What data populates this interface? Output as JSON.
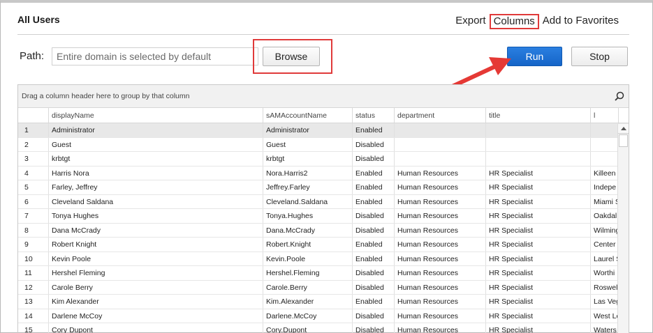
{
  "header": {
    "title": "All Users",
    "export_label": "Export",
    "columns_label": "Columns",
    "favorites_label": "Add to Favorites"
  },
  "path": {
    "label": "Path:",
    "placeholder": "Entire domain is selected by default"
  },
  "buttons": {
    "browse": "Browse",
    "run": "Run",
    "stop": "Stop"
  },
  "grid": {
    "group_hint": "Drag a column header here to group by that column",
    "columns": [
      "displayName",
      "sAMAccountName",
      "status",
      "department",
      "title",
      "l"
    ],
    "rows": [
      [
        "1",
        "Administrator",
        "Administrator",
        "Enabled",
        "",
        "",
        ""
      ],
      [
        "2",
        "Guest",
        "Guest",
        "Disabled",
        "",
        "",
        ""
      ],
      [
        "3",
        "krbtgt",
        "krbtgt",
        "Disabled",
        "",
        "",
        ""
      ],
      [
        "4",
        "Harris Nora",
        "Nora.Harris2",
        "Enabled",
        "Human Resources",
        "HR Specialist",
        "Killeen"
      ],
      [
        "5",
        "Farley, Jeffrey",
        "Jeffrey.Farley",
        "Enabled",
        "Human Resources",
        "HR Specialist",
        "Indepe"
      ],
      [
        "6",
        "Cleveland Saldana",
        "Cleveland.Saldana",
        "Enabled",
        "Human Resources",
        "HR Specialist",
        "Miami S"
      ],
      [
        "7",
        "Tonya Hughes",
        "Tonya.Hughes",
        "Disabled",
        "Human Resources",
        "HR Specialist",
        "Oakdal"
      ],
      [
        "8",
        "Dana McCrady",
        "Dana.McCrady",
        "Disabled",
        "Human Resources",
        "HR Specialist",
        "Wilming"
      ],
      [
        "9",
        "Robert Knight",
        "Robert.Knight",
        "Enabled",
        "Human Resources",
        "HR Specialist",
        "Center"
      ],
      [
        "10",
        "Kevin Poole",
        "Kevin.Poole",
        "Enabled",
        "Human Resources",
        "HR Specialist",
        "Laurel S"
      ],
      [
        "11",
        "Hershel Fleming",
        "Hershel.Fleming",
        "Disabled",
        "Human Resources",
        "HR Specialist",
        "Worthi"
      ],
      [
        "12",
        "Carole Berry",
        "Carole.Berry",
        "Disabled",
        "Human Resources",
        "HR Specialist",
        "Roswel"
      ],
      [
        "13",
        "Kim Alexander",
        "Kim.Alexander",
        "Enabled",
        "Human Resources",
        "HR Specialist",
        "Las Veg"
      ],
      [
        "14",
        "Darlene McCoy",
        "Darlene.McCoy",
        "Disabled",
        "Human Resources",
        "HR Specialist",
        "West Lo"
      ],
      [
        "15",
        "Cory Dupont",
        "Cory.Dupont",
        "Disabled",
        "Human Resources",
        "HR Specialist",
        "Waters"
      ]
    ]
  },
  "colors": {
    "accent": "#1565c8",
    "highlight": "#e03a3a"
  },
  "icons": {
    "search": "search-icon",
    "annotation": "red-arrow-icon"
  }
}
